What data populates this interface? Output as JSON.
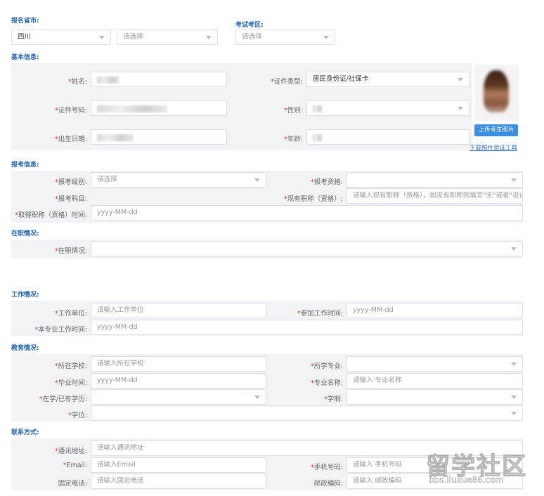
{
  "top": {
    "province_label": "报名省市:",
    "province_value": "四川",
    "city_placeholder": "请选择",
    "exam_area_label": "考试考区:",
    "exam_area_placeholder": "请选择"
  },
  "basic": {
    "title": "基本信息:",
    "name_label": "姓名:",
    "id_type_label": "证件类型:",
    "id_type_value": "居民身份证/社保卡",
    "id_number_label": "证件号码:",
    "gender_label": "性别:",
    "birthdate_label": "出生日期:",
    "age_label": "年龄:",
    "upload_photo": "上传考生照片",
    "download_tool": "下载照片验证工具"
  },
  "exam": {
    "title": "报考信息:",
    "level_label": "报考级别:",
    "level_placeholder": "请选择",
    "qualification_label": "报考资格:",
    "subject_label": "报考科目:",
    "current_title_label": "现有职称（资格）:",
    "current_title_placeholder": "请输入现有职称（资格），如没有职称则填写\"无\"或者\"设计",
    "obtain_time_label": "取得职称（资格）时间:",
    "obtain_time_placeholder": "yyyy-MM-dd"
  },
  "employment": {
    "title": "在职情况:",
    "status_label": "在职情况:"
  },
  "work": {
    "title": "工作情况:",
    "unit_label": "工作单位:",
    "unit_placeholder": "请输入工作单位",
    "start_label": "参加工作时间:",
    "start_placeholder": "yyyy-MM-dd",
    "major_time_label": "本专业工作时间:",
    "major_time_placeholder": "yyyy-MM-dd"
  },
  "education": {
    "title": "教育情况:",
    "school_label": "所在学校:",
    "school_placeholder": "请输入所在学校",
    "major_label": "所学专业:",
    "grad_label": "毕业时间:",
    "grad_placeholder": "yyyy-MM-dd",
    "major_name_label": "专业名称:",
    "major_name_placeholder": "请输入 专业名称",
    "degree_status_label": "在学/已有学历:",
    "system_label": "学制:",
    "degree_label": "学位:"
  },
  "contact": {
    "title": "联系方式:",
    "address_label": "通讯地址:",
    "address_placeholder": "请输入通讯地址",
    "email_label": "Email:",
    "email_placeholder": "请输入Email",
    "mobile_label": "手机号码:",
    "mobile_placeholder": "请输入 手机号码",
    "phone_label": "固定电话:",
    "phone_placeholder": "请输入固定电话",
    "postcode_label": "邮政编码:",
    "postcode_placeholder": "请输入 邮政编码"
  },
  "watermark": {
    "text": "留学社区",
    "url": "bbs.liuxue86.com"
  }
}
